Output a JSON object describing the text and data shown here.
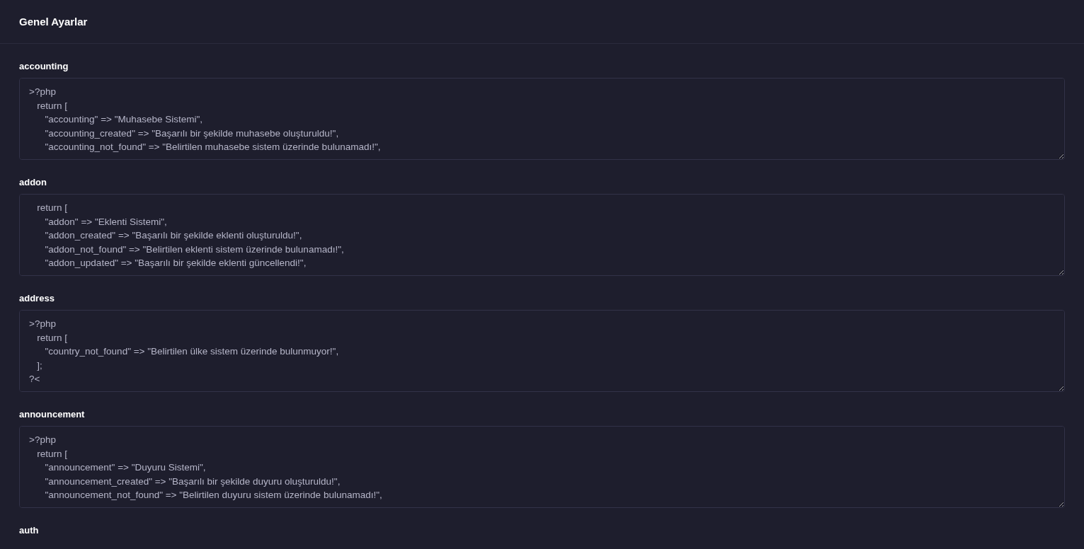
{
  "header": {
    "title": "Genel Ayarlar"
  },
  "sections": [
    {
      "label": "accounting",
      "lines": [
        ">?php",
        "   return [",
        "      \"accounting\" => \"Muhasebe Sistemi\",",
        "      \"accounting_created\" => \"Başarılı bir şekilde muhasebe oluşturuldu!\",",
        "      \"accounting_not_found\" => \"Belirtilen muhasebe sistem üzerinde bulunamadı!\","
      ]
    },
    {
      "label": "addon",
      "lines": [
        "   return [",
        "      \"addon\" => \"Eklenti Sistemi\",",
        "      \"addon_created\" => \"Başarılı bir şekilde eklenti oluşturuldu!\",",
        "      \"addon_not_found\" => \"Belirtilen eklenti sistem üzerinde bulunamadı!\",",
        "      \"addon_updated\" => \"Başarılı bir şekilde eklenti güncellendi!\","
      ]
    },
    {
      "label": "address",
      "lines": [
        ">?php",
        "   return [",
        "      \"country_not_found\" => \"Belirtilen ülke sistem üzerinde bulunmuyor!\",",
        "   ];",
        "?<"
      ]
    },
    {
      "label": "announcement",
      "lines": [
        ">?php",
        "   return [",
        "      \"announcement\" => \"Duyuru Sistemi\",",
        "      \"announcement_created\" => \"Başarılı bir şekilde duyuru oluşturuldu!\",",
        "      \"announcement_not_found\" => \"Belirtilen duyuru sistem üzerinde bulunamadı!\","
      ]
    },
    {
      "label": "auth"
    }
  ]
}
